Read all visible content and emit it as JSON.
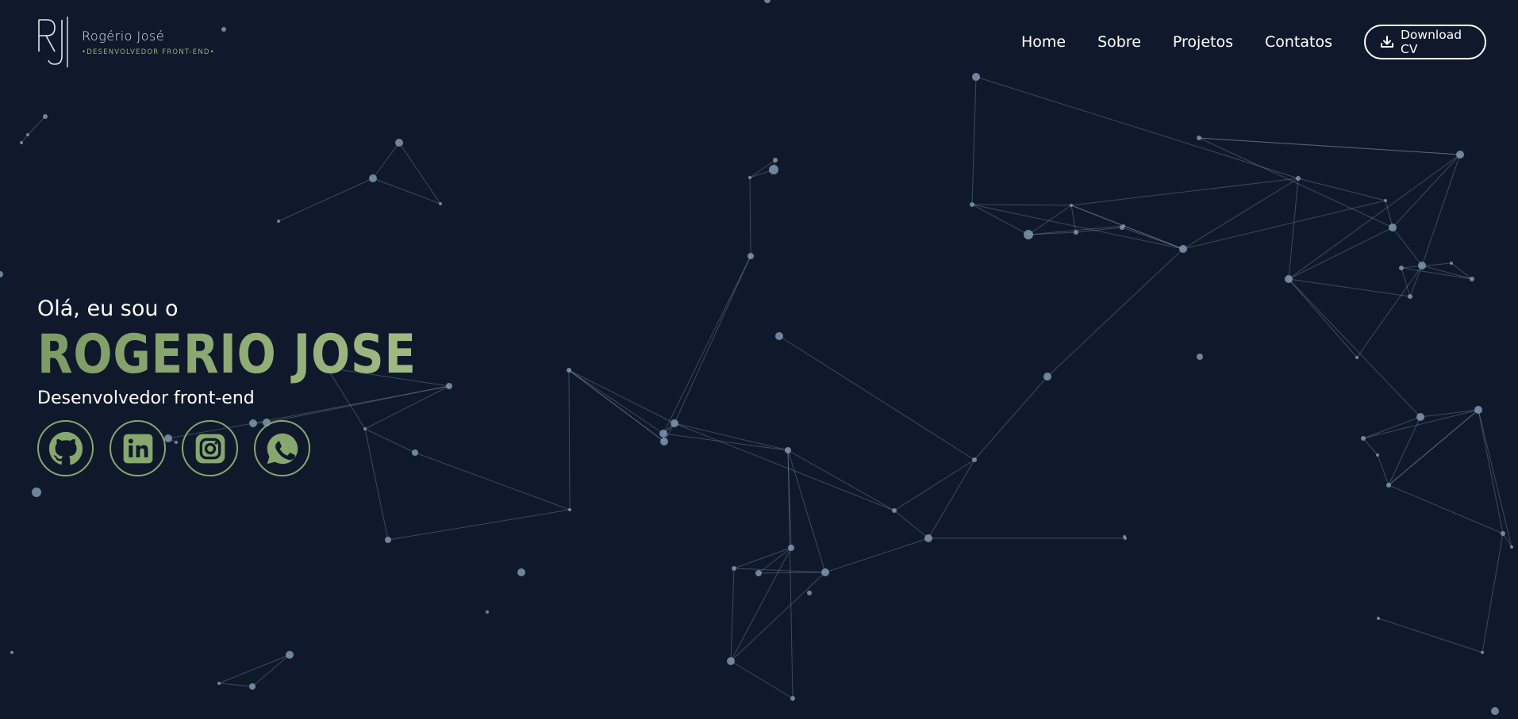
{
  "brand": {
    "name": "Rogério José",
    "tagline": "•DESENVOLVEDOR FRONT-END•"
  },
  "nav": {
    "items": [
      {
        "label": "Home"
      },
      {
        "label": "Sobre"
      },
      {
        "label": "Projetos"
      },
      {
        "label": "Contatos"
      }
    ],
    "cv_button": {
      "label": "Download CV",
      "icon": "download-icon"
    }
  },
  "hero": {
    "greeting": "Olá, eu sou o",
    "name": "ROGERIO JOSE",
    "role": "Desenvolvedor front-end"
  },
  "socials": [
    {
      "icon": "github-icon"
    },
    {
      "icon": "linkedin-icon"
    },
    {
      "icon": "instagram-icon"
    },
    {
      "icon": "whatsapp-icon"
    }
  ],
  "colors": {
    "background": "#10192b",
    "accent": "#86a86d",
    "particle": "#7f98b0",
    "text": "#ffffff"
  }
}
